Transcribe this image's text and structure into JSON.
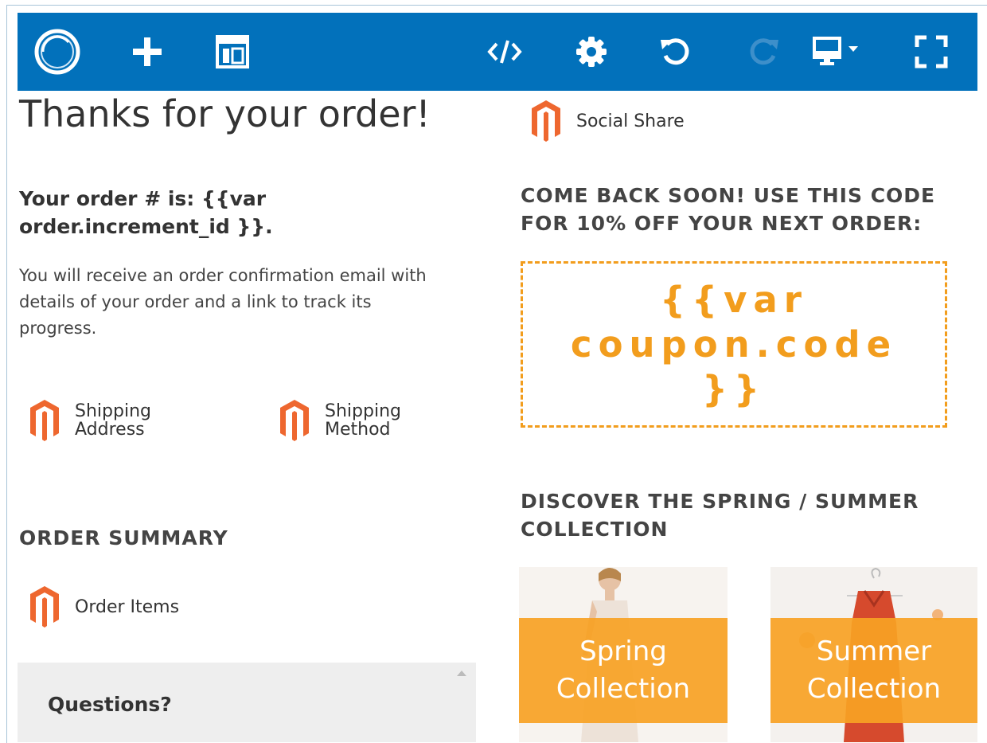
{
  "toolbar": {
    "icons": [
      "logo-ring-icon",
      "add-icon",
      "layout-icon",
      "code-icon",
      "settings-icon",
      "undo-icon",
      "redo-icon",
      "device-preview-icon",
      "fullscreen-icon"
    ]
  },
  "left": {
    "title": "Thanks for your order!",
    "order_number_text": "Your order # is: {{var order.increment_id }}.",
    "confirmation_text": "You will receive an order confirmation email with details of your order and a link to track its progress.",
    "shipping_address_label": "Shipping Address",
    "shipping_method_label": "Shipping Method",
    "order_summary_heading": "ORDER SUMMARY",
    "order_items_label": "Order Items",
    "questions_heading": "Questions?"
  },
  "right": {
    "social_share_label": "Social Share",
    "coupon_heading": "COME BACK SOON! USE THIS CODE FOR 10% OFF YOUR NEXT ORDER:",
    "coupon_code": "{{var coupon.code }}",
    "collection_heading": "DISCOVER THE SPRING / SUMMER COLLECTION",
    "spring_label": "Spring Collection",
    "summer_label": "Summer Collection"
  },
  "colors": {
    "toolbar": "#0271bb",
    "accent_orange": "#f29d1d",
    "magento_orange": "#ee672f"
  }
}
